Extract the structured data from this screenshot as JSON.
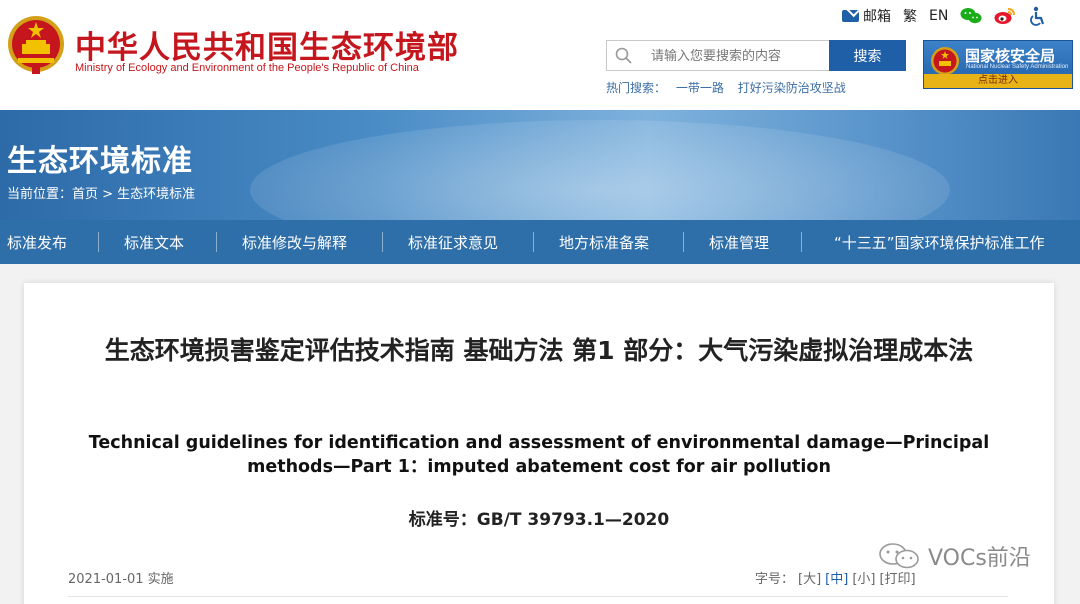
{
  "header": {
    "ministry_cn": "中华人民共和国生态环境部",
    "ministry_en": "Ministry of Ecology and Environment of the People's Republic of China",
    "top_links": {
      "mail": "邮箱",
      "traditional": "繁",
      "english": "EN"
    },
    "search": {
      "placeholder": "请输入您要搜索的内容",
      "button": "搜索"
    },
    "hot_search": {
      "label": "热门搜索：",
      "items": [
        "一带一路",
        "打好污染防治攻坚战"
      ]
    },
    "nnsa": {
      "title": "国家核安全局",
      "subtitle": "National Nuclear Safety Administration",
      "enter": "点击进入"
    }
  },
  "banner": {
    "title": "生态环境标准",
    "breadcrumb": "当前位置：首页 > 生态环境标准"
  },
  "nav": {
    "items": [
      "标准发布",
      "标准文本",
      "标准修改与解释",
      "标准征求意见",
      "地方标准备案",
      "标准管理",
      "“十三五”国家环境保护标准工作"
    ]
  },
  "document": {
    "title_cn": "生态环境损害鉴定评估技术指南 基础方法 第1 部分：大气污染虚拟治理成本法",
    "title_en": "Technical guidelines for identification and assessment of environmental damage—Principal methods—Part 1：imputed abatement cost for air pollution",
    "standard_no": "标准号：GB/T 39793.1—2020",
    "implementation": "2021-01-01 实施",
    "font_size": {
      "label": "字号：",
      "large": "[大]",
      "medium": "[中]",
      "small": "[小]",
      "print": "[打印]"
    }
  },
  "watermark": "VOCs前沿",
  "colors": {
    "brand_red": "#c5161d",
    "nav_blue": "#2e6ea9",
    "button_blue": "#1f5fa8"
  }
}
